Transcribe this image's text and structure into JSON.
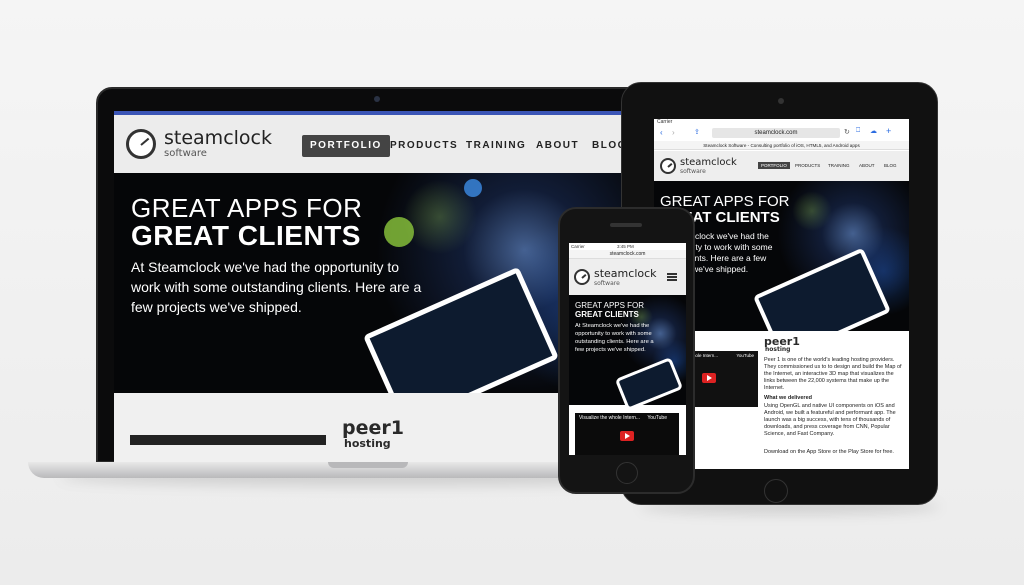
{
  "laptop": {
    "brand_name": "steamclock",
    "brand_sub": "software",
    "nav": [
      "PORTFOLIO",
      "PRODUCTS",
      "TRAINING",
      "ABOUT",
      "BLOG"
    ],
    "hero_line1": "GREAT APPS FOR",
    "hero_line2": "GREAT CLIENTS",
    "hero_paragraph": "At Steamclock we've had the opportunity to work with some outstanding clients. Here are a few projects we've shipped.",
    "peer1_logo": "peer1",
    "peer1_sub": "hosting"
  },
  "tablet": {
    "carrier": "Carrier",
    "url": "steamclock.com",
    "page_title": "Steamclock Software - Consulting portfolio of iOS, HTML5, and Android apps",
    "brand_name": "steamclock",
    "brand_sub": "software",
    "nav": [
      "PORTFOLIO",
      "PRODUCTS",
      "TRAINING",
      "ABOUT",
      "BLOG"
    ],
    "hero_line1": "GREAT APPS FOR",
    "hero_line2": "GREAT CLIENTS",
    "hero_paragraph": "At Steamclock we've had the opportunity to work with some great clients. Here are a few projects we've shipped.",
    "peer1_logo": "peer1",
    "peer1_sub": "hosting",
    "video_title": "Visualize the whole Intern...",
    "video_brand": "YouTube",
    "body_intro": "Peer 1 is one of the world's leading hosting providers. They commissioned us to to design and build the Map of the Internet, an interactive 3D map that visualizes the links between the 22,000 systems that make up the Internet.",
    "delivered_heading": "What we delivered",
    "delivered_text": "Using OpenGL and native UI components on iOS and Android, we built a featureful and performant app. The launch was a big success, with tens of thousands of downloads, and press coverage from CNN, Popular Science, and Fast Company.",
    "download_text": "Download on the App Store or the Play Store for free."
  },
  "phone": {
    "carrier": "Carrier",
    "time": "3:45 PM",
    "url": "steamclock.com",
    "brand_name": "steamclock",
    "brand_sub": "software",
    "hero_line1": "GREAT APPS FOR",
    "hero_line2": "GREAT CLIENTS",
    "hero_paragraph": "At Steamclock we've had the opportunity to work with some outstanding clients. Here are a few projects we've shipped.",
    "video_title": "Visualize the whole Intern...",
    "video_brand": "YouTube"
  }
}
